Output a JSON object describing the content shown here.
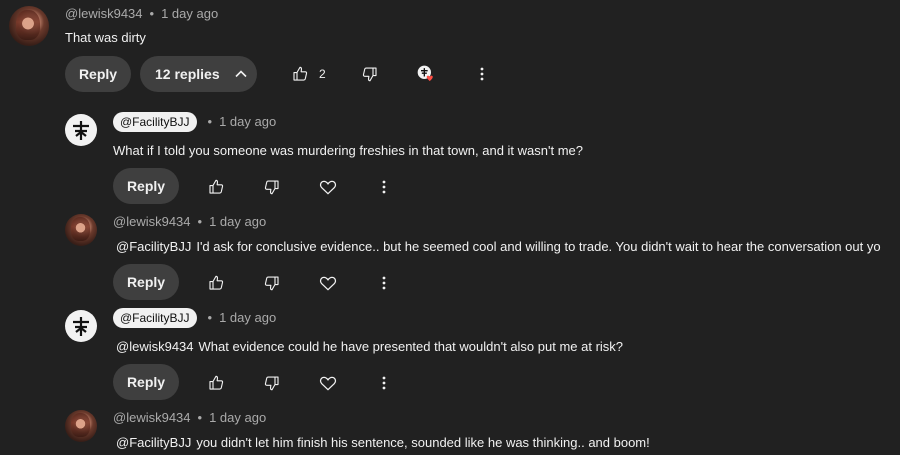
{
  "top_comment": {
    "author": "@lewisk9434",
    "time": "1 day ago",
    "text": "That was dirty",
    "reply_label": "Reply",
    "replies_label": "12 replies",
    "like_count": "2"
  },
  "replies": [
    {
      "author": "@FacilityBJJ",
      "time": "1 day ago",
      "mention": "",
      "text": "What if I told you someone was murdering freshies in that town, and it wasn't me?",
      "reply_label": "Reply"
    },
    {
      "author": "@lewisk9434",
      "time": "1 day ago",
      "mention": "@FacilityBJJ",
      "text": "I'd ask for conclusive evidence.. but he seemed cool and willing to trade. You didn't wait to hear the conversation out yo",
      "reply_label": "Reply"
    },
    {
      "author": "@FacilityBJJ",
      "time": "1 day ago",
      "mention": "@lewisk9434",
      "text": "What evidence could he have presented that wouldn't also put me at risk?",
      "reply_label": "Reply"
    },
    {
      "author": "@lewisk9434",
      "time": "1 day ago",
      "mention": "@FacilityBJJ",
      "text": "you didn't let him finish his sentence, sounded like he was thinking.. and boom!",
      "reply_label": "Reply"
    }
  ],
  "icons": {
    "like": "thumbs-up-icon",
    "dislike": "thumbs-down-icon",
    "heart": "heart-icon",
    "more": "more-vertical-icon",
    "chevron": "chevron-up-icon"
  },
  "colors": {
    "background": "#212121",
    "pill": "#3f3f3f",
    "meta_text": "#aaaaaa",
    "heart_red": "#ff4e45"
  }
}
